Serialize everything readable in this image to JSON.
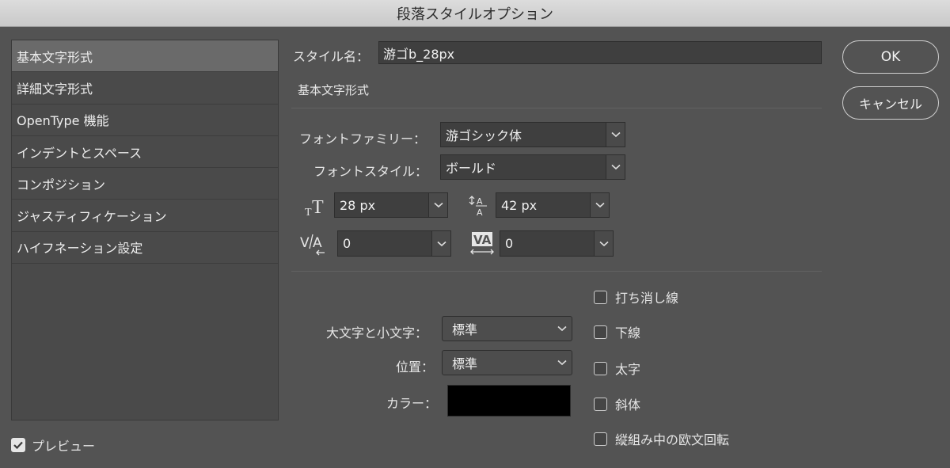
{
  "window": {
    "title": "段落スタイルオプション"
  },
  "sidebar": {
    "items": [
      {
        "label": "基本文字形式",
        "selected": true
      },
      {
        "label": "詳細文字形式"
      },
      {
        "label": "OpenType 機能"
      },
      {
        "label": "インデントとスペース"
      },
      {
        "label": "コンポジション"
      },
      {
        "label": "ジャスティフィケーション"
      },
      {
        "label": "ハイフネーション設定"
      }
    ]
  },
  "preview": {
    "label": "プレビュー",
    "checked": true
  },
  "style_name": {
    "label": "スタイル名：",
    "value": "游ゴb_28px"
  },
  "section": {
    "title": "基本文字形式"
  },
  "font_family": {
    "label": "フォントファミリー：",
    "value": "游ゴシック体"
  },
  "font_style": {
    "label": "フォントスタイル：",
    "value": "ボールド"
  },
  "font_size": {
    "value": "28 px",
    "icon": "font-size-icon"
  },
  "leading": {
    "value": "42 px",
    "icon": "leading-icon"
  },
  "kerning": {
    "value": "0",
    "icon": "kerning-icon"
  },
  "tracking": {
    "value": "0",
    "icon": "tracking-icon"
  },
  "case": {
    "label": "大文字と小文字：",
    "value": "標準"
  },
  "position": {
    "label": "位置：",
    "value": "標準"
  },
  "color": {
    "label": "カラー：",
    "value": "#000000"
  },
  "options": [
    {
      "label": "打ち消し線",
      "checked": false
    },
    {
      "label": "下線",
      "checked": false
    },
    {
      "label": "太字",
      "checked": false
    },
    {
      "label": "斜体",
      "checked": false
    },
    {
      "label": "縦組み中の欧文回転",
      "checked": false
    }
  ],
  "buttons": {
    "ok": "OK",
    "cancel": "キャンセル"
  }
}
